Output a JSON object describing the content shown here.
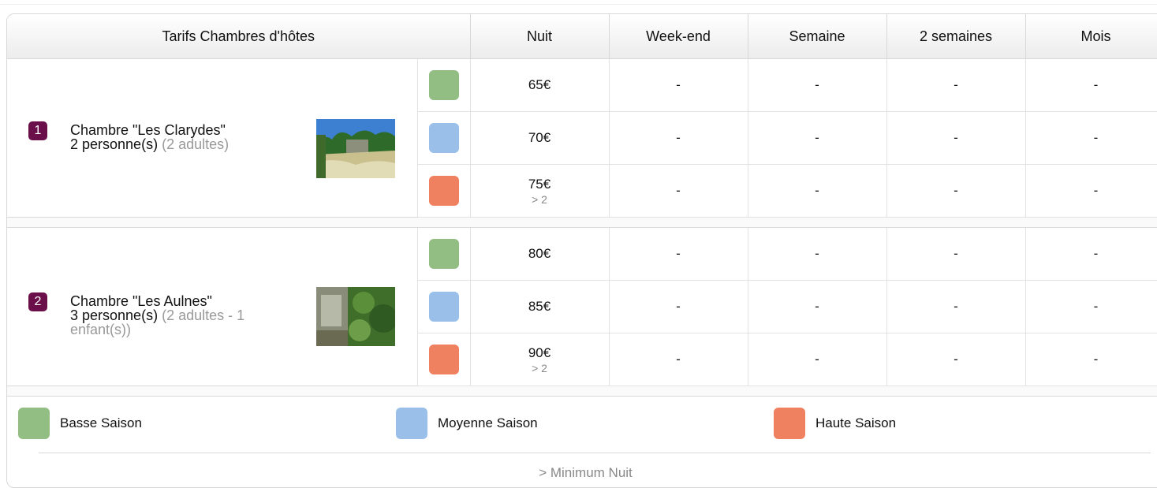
{
  "colors": {
    "basse": "#93be83",
    "moyenne": "#9ac0ea",
    "haute": "#ef8161",
    "badge": "#6b0f4a"
  },
  "header": {
    "title": "Tarifs Chambres d'hôtes",
    "col_nuit": "Nuit",
    "col_weekend": "Week-end",
    "col_semaine": "Semaine",
    "col_2semaines": "2 semaines",
    "col_mois": "Mois"
  },
  "rooms": [
    {
      "number": "1",
      "name": "Chambre \"Les Clarydes\"",
      "capacity": "2 personne(s)",
      "detail": "(2 adultes)",
      "rates": [
        {
          "season": "basse",
          "nuit": "65€",
          "min": "",
          "weekend": "-",
          "semaine": "-",
          "deux_semaines": "-",
          "mois": "-"
        },
        {
          "season": "moyenne",
          "nuit": "70€",
          "min": "",
          "weekend": "-",
          "semaine": "-",
          "deux_semaines": "-",
          "mois": "-"
        },
        {
          "season": "haute",
          "nuit": "75€",
          "min": "> 2",
          "weekend": "-",
          "semaine": "-",
          "deux_semaines": "-",
          "mois": "-"
        }
      ]
    },
    {
      "number": "2",
      "name": "Chambre \"Les Aulnes\"",
      "capacity": "3 personne(s)",
      "detail": "(2 adultes - 1 enfant(s))",
      "rates": [
        {
          "season": "basse",
          "nuit": "80€",
          "min": "",
          "weekend": "-",
          "semaine": "-",
          "deux_semaines": "-",
          "mois": "-"
        },
        {
          "season": "moyenne",
          "nuit": "85€",
          "min": "",
          "weekend": "-",
          "semaine": "-",
          "deux_semaines": "-",
          "mois": "-"
        },
        {
          "season": "haute",
          "nuit": "90€",
          "min": "> 2",
          "weekend": "-",
          "semaine": "-",
          "deux_semaines": "-",
          "mois": "-"
        }
      ]
    }
  ],
  "legend": {
    "basse": "Basse Saison",
    "moyenne": "Moyenne Saison",
    "haute": "Haute Saison",
    "footnote": "> Minimum Nuit"
  }
}
